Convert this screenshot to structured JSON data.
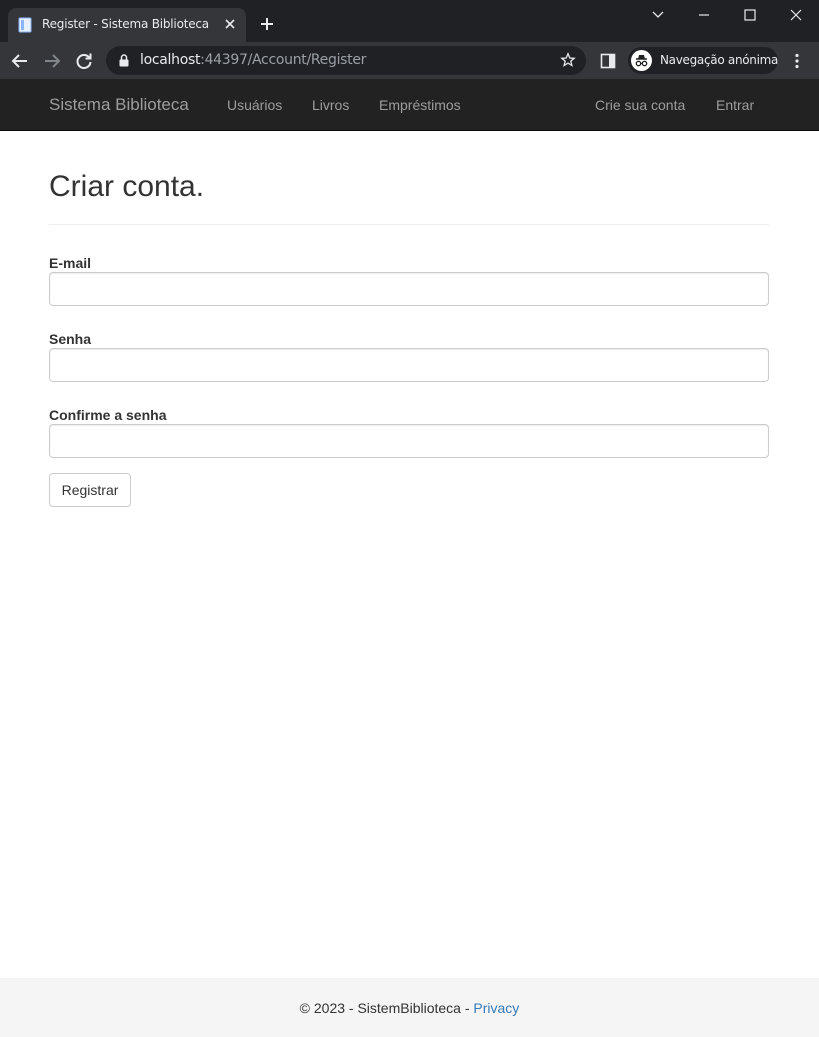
{
  "browser": {
    "tab_title": "Register - Sistema Biblioteca",
    "url_host": "localhost",
    "url_path": ":44397/Account/Register",
    "incognito_label": "Navegação anónima"
  },
  "navbar": {
    "brand": "Sistema Biblioteca",
    "links": [
      {
        "label": "Usuários"
      },
      {
        "label": "Livros"
      },
      {
        "label": "Empréstimos"
      }
    ],
    "right_links": [
      {
        "label": "Crie sua conta"
      },
      {
        "label": "Entrar"
      }
    ]
  },
  "page": {
    "title": "Criar conta.",
    "fields": [
      {
        "label": "E-mail",
        "value": ""
      },
      {
        "label": "Senha",
        "value": ""
      },
      {
        "label": "Confirme a senha",
        "value": ""
      }
    ],
    "submit_label": "Registrar"
  },
  "footer": {
    "text": "© 2023 - SistemBiblioteca - ",
    "link": "Privacy"
  },
  "colors": {
    "navbar_bg": "#222222",
    "link": "#337ab7",
    "footer_bg": "#f5f5f5"
  }
}
